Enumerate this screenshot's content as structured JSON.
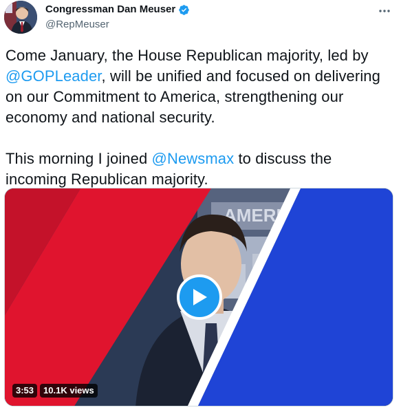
{
  "author": {
    "display_name": "Congressman Dan Meuser",
    "handle": "@RepMeuser",
    "verified_icon": "verified-badge-icon",
    "avatar": "avatar-photo"
  },
  "menu": {
    "more_icon": "more-dots-icon"
  },
  "tweet": {
    "p1_before": "Come January, the House Republican majority, led by ",
    "p1_mention": "@GOPLeader",
    "p1_after": ", will be unified and focused on delivering on our Commitment to America, strengthening our economy and national security.",
    "p2_before": "This morning I joined ",
    "p2_mention": "@Newsmax",
    "p2_after": " to discuss the incoming Republican majority."
  },
  "video": {
    "duration": "3:53",
    "views": "10.1K views",
    "backdrop_text": "AMERI",
    "play_icon": "play-icon"
  },
  "colors": {
    "accent": "#1d9bf0",
    "red_stripe": "#e0142e",
    "blue_stripe": "#1f44d6",
    "text": "#0f1419",
    "secondary_text": "#536471"
  }
}
